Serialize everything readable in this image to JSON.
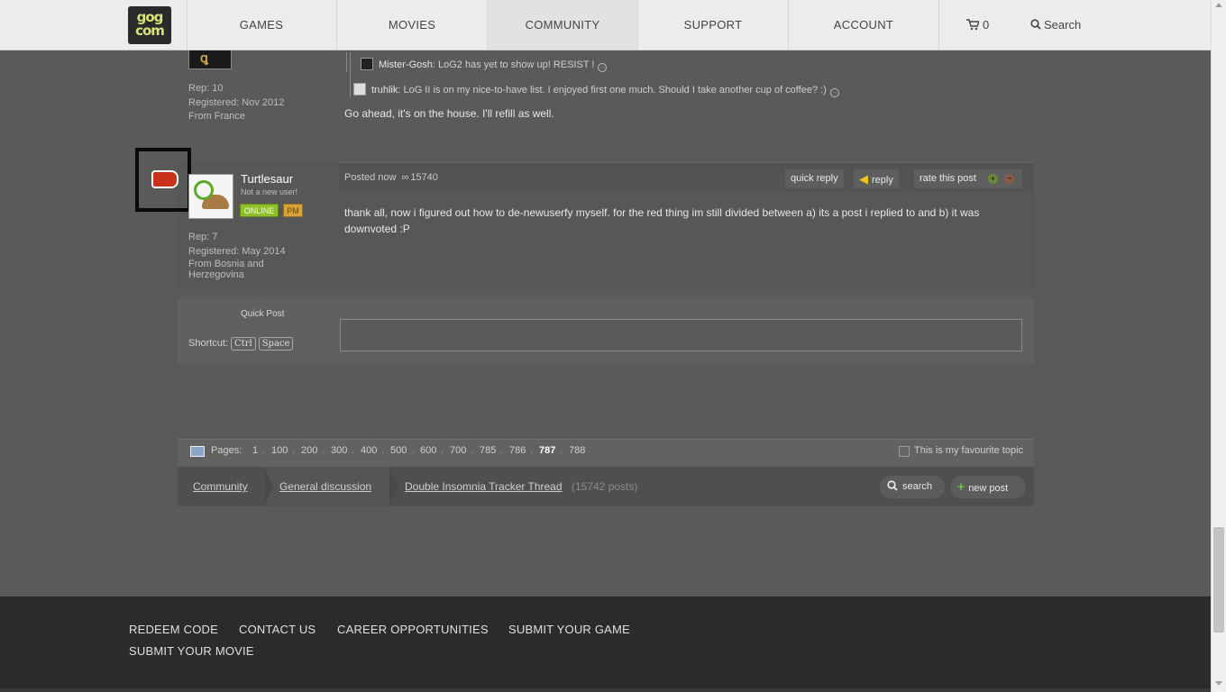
{
  "nav": {
    "logo_top": "gog",
    "logo_bottom": "com",
    "items": [
      "GAMES",
      "MOVIES",
      "COMMUNITY",
      "SUPPORT",
      "ACCOUNT"
    ],
    "cart_count": "0",
    "search_label": "Search"
  },
  "prev_post": {
    "rep": "Rep: 10",
    "registered": "Registered: Nov 2012",
    "from": "From France",
    "quotes": [
      {
        "user": "Mister-Gosh",
        "text": ": LoG2 has yet to show up! RESIST !"
      },
      {
        "user": "truhlik",
        "text": ": LoG II is on my nice-to-have list. I enjoyed first one much. Should I take another cup of coffee? :)"
      }
    ],
    "text": "Go ahead, it's on the house. I'll refill as well."
  },
  "post": {
    "username": "Turtlesaur",
    "user_title": "Not a new user!",
    "online": "ONLINE",
    "pm": "PM",
    "rep": "Rep: 7",
    "registered": "Registered: May 2014",
    "from": "From Bosnia and Herzegovina",
    "posted": "Posted now",
    "post_number": "15740",
    "quick_reply": "quick reply",
    "reply": "reply",
    "rate": "rate this post",
    "text": "thank all, now i figured out how to de-newuserfy myself. for the red thing im still divided between a) its a post i replied to and b) it was downvoted :P"
  },
  "quickpost": {
    "label": "Quick Post",
    "shortcut": "Shortcut:",
    "key1": "Ctrl",
    "key2": "Space"
  },
  "pagination": {
    "label": "Pages:",
    "pages": [
      "1",
      "100",
      "200",
      "300",
      "400",
      "500",
      "600",
      "700",
      "785",
      "786",
      "787",
      "788"
    ],
    "current": "787",
    "favourite": "This is my favourite topic"
  },
  "breadcrumb": {
    "items": [
      "Community",
      "General discussion",
      "Double Insomnia Tracker Thread"
    ],
    "count": "(15742 posts)",
    "search": "search",
    "new_post": "new post"
  },
  "footer": {
    "links": [
      "REDEEM CODE",
      "CONTACT US",
      "CAREER OPPORTUNITIES",
      "SUBMIT YOUR GAME",
      "SUBMIT YOUR MOVIE"
    ]
  }
}
